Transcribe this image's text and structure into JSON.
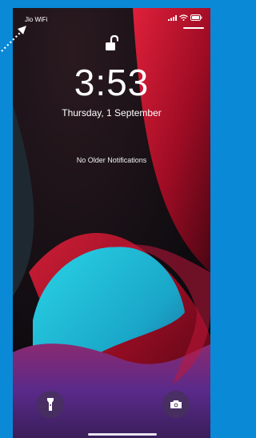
{
  "status_bar": {
    "carrier": "Jio WiFi",
    "signal_icon": "signal-bars-icon",
    "wifi_icon": "wifi-icon",
    "battery_icon": "battery-icon"
  },
  "lock_screen": {
    "lock_icon": "unlocked-padlock-icon",
    "time": "3:53",
    "date": "Thursday, 1 September",
    "notifications_text": "No Older Notifications"
  },
  "controls": {
    "flashlight_icon": "flashlight-icon",
    "camera_icon": "camera-icon"
  },
  "colors": {
    "page_background": "#0a89d6",
    "wallpaper_red": "#b0102a",
    "wallpaper_cyan": "#1ec3d9",
    "wallpaper_purple": "#6e2a86"
  }
}
